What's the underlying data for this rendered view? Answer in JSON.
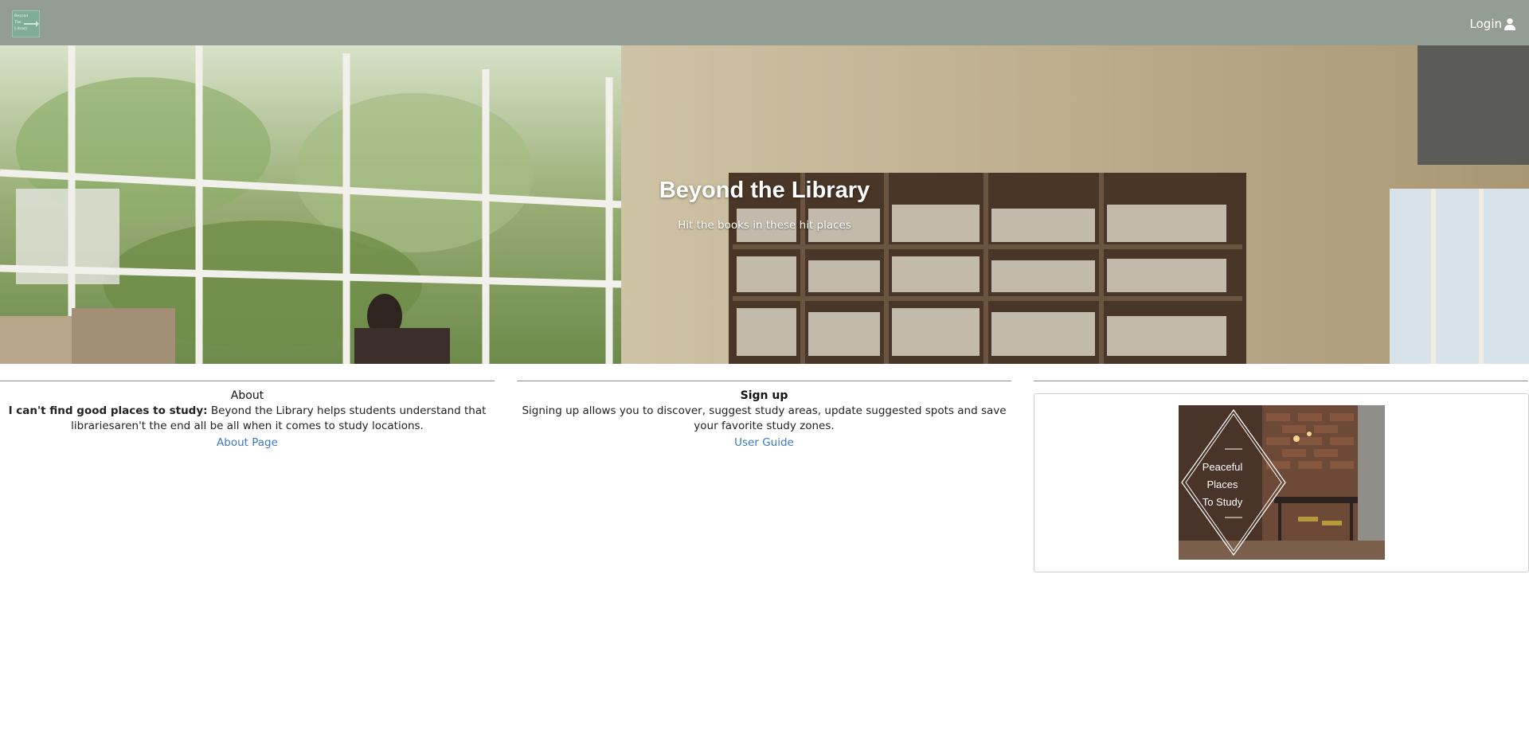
{
  "navbar": {
    "logo_text": [
      "Beyond",
      "The",
      "Library"
    ],
    "login_label": "Login",
    "login_icon": "user-icon",
    "background_color": "#949d93"
  },
  "hero": {
    "title": "Beyond the Library",
    "subtitle": "Hit the books in these hit places"
  },
  "about": {
    "heading": "About",
    "lead": "I can't find good places to study:",
    "body": " Beyond the Library helps students understand that librariesaren't the end all be all when it comes to study locations.",
    "link_label": "About Page"
  },
  "signup": {
    "heading": "Sign up",
    "body": "Signing up allows you to discover, suggest study areas, update suggested spots and save your favorite study zones.",
    "link_label": "User Guide"
  },
  "feature_image": {
    "caption_lines": [
      "Peaceful",
      "Places",
      "To Study"
    ]
  },
  "colors": {
    "link": "#3b78c0",
    "navbar": "#949d93"
  }
}
